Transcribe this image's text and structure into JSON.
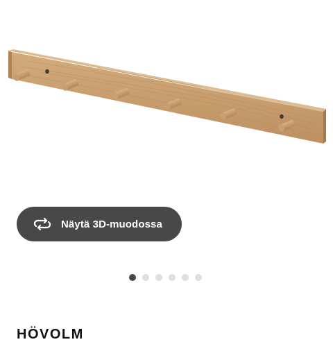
{
  "product": {
    "name": "HÖVOLM",
    "image_alt": "Wooden coat rack with six pegs"
  },
  "view_3d_button": {
    "label": "Näytä 3D-muodossa",
    "icon": "rotate-3d-icon"
  },
  "carousel": {
    "dot_count": 6,
    "active_index": 0
  },
  "colors": {
    "button_bg": "#484848",
    "dot_active": "#484848",
    "dot_inactive": "#dfdfdf",
    "wood": "#c9a173"
  }
}
